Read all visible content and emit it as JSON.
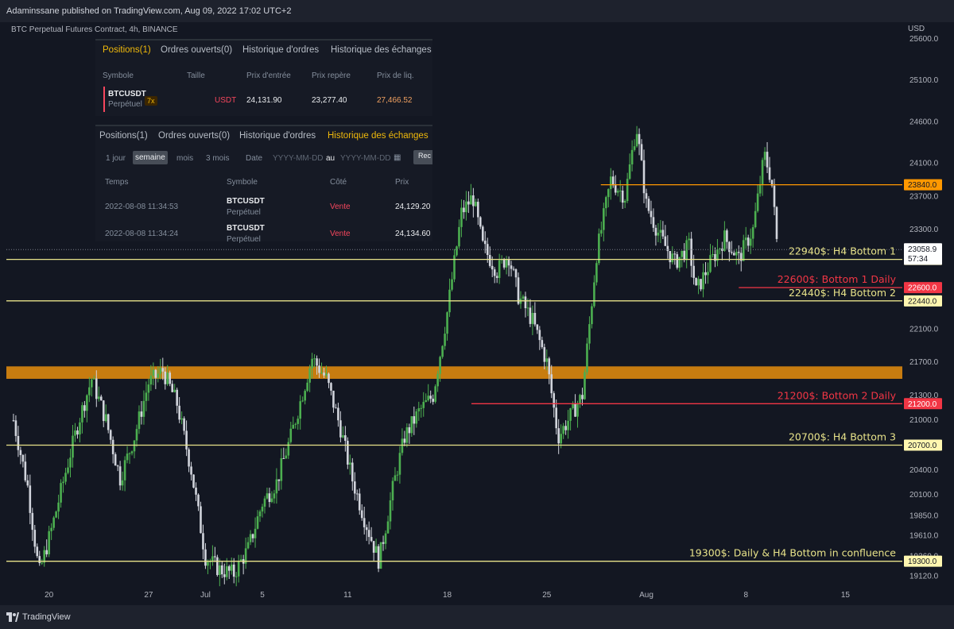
{
  "header": {
    "publish_text": "Adaminssane published on TradingView.com, Aug 09, 2022 17:02 UTC+2",
    "symbol_text": "BTC Perpetual Futures Contract, 4h, BINANCE",
    "currency": "USD"
  },
  "footer": {
    "brand": "TradingView"
  },
  "colors": {
    "background": "#131722",
    "up_candle": "#4caf50",
    "down_candle": "#d1d4dc",
    "support_line": "#e8e38a",
    "daily_line": "#f23645",
    "resistance": "#ff9800",
    "zone": "#c77c10"
  },
  "positions_panel": {
    "tabs": [
      "Positions(1)",
      "Ordres ouverts(0)",
      "Historique d'ordres",
      "Historique des échanges"
    ],
    "active_tab": 0,
    "headers": [
      "Symbole",
      "Taille",
      "Prix d'entrée",
      "Prix repère",
      "Prix de liq."
    ],
    "row": {
      "symbol": "BTCUSDT",
      "type": "Perpétuel",
      "leverage": "7x",
      "size_unit": "USDT",
      "entry": "24,131.90",
      "mark": "23,277.40",
      "liq": "27,466.52"
    }
  },
  "trades_panel": {
    "tabs": [
      "Positions(1)",
      "Ordres ouverts(0)",
      "Historique d'ordres",
      "Historique des échanges"
    ],
    "active_tab": 3,
    "filters": [
      "1 jour",
      "semaine",
      "mois",
      "3 mois"
    ],
    "active_filter": 1,
    "date_label": "Date",
    "date_from": "YYYY-MM-DD",
    "date_sep": "au",
    "date_to": "YYYY-MM-DD",
    "search_button": "Rec",
    "headers": [
      "Temps",
      "Symbole",
      "Côté",
      "Prix"
    ],
    "rows": [
      {
        "time": "2022-08-08 11:34:53",
        "symbol": "BTCUSDT",
        "type": "Perpétuel",
        "side": "Vente",
        "price": "24,129.20"
      },
      {
        "time": "2022-08-08 11:34:24",
        "symbol": "BTCUSDT",
        "type": "Perpétuel",
        "side": "Vente",
        "price": "24,134.60"
      }
    ]
  },
  "chart_data": {
    "type": "candlestick",
    "title": "BTC Perpetual Futures Contract, 4h, BINANCE",
    "ylabel": "USD",
    "ylim": [
      19000,
      25800
    ],
    "y_ticks": [
      "25600.0",
      "25100.0",
      "24600.0",
      "24100.0",
      "23700.0",
      "23300.0",
      "22100.0",
      "21700.0",
      "21300.0",
      "21000.0",
      "20400.0",
      "20100.0",
      "19850.0",
      "19610.0",
      "19360.0",
      "19120.0"
    ],
    "x_ticks": [
      "20",
      "27",
      "Jul",
      "5",
      "11",
      "18",
      "25",
      "Aug",
      "8",
      "15"
    ],
    "x_ticks_days": [
      20,
      27,
      31,
      35,
      41,
      48,
      55,
      62,
      69,
      76
    ],
    "x_range_days": [
      17,
      80
    ],
    "grid": false,
    "current_price": {
      "value": 23058.9,
      "label": "23058.9",
      "countdown": "57:34"
    },
    "levels": [
      {
        "price": 23840,
        "label_tag": "23840.0",
        "text": "",
        "color": "#ff9800",
        "start_day": 58.8
      },
      {
        "price": 22940,
        "label_tag": "22940.0",
        "text": "22940$: H4 Bottom 1",
        "color": "#e8e38a",
        "start_day": 17
      },
      {
        "price": 22600,
        "label_tag": "22600.0",
        "text": "22600$: Bottom 1 Daily",
        "color": "#f23645",
        "start_day": 68.5
      },
      {
        "price": 22440,
        "label_tag": "22440.0",
        "text": "22440$: H4 Bottom 2",
        "color": "#e8e38a",
        "start_day": 17
      },
      {
        "price": 21200,
        "label_tag": "21200.0",
        "text": "21200$: Bottom 2 Daily",
        "color": "#f23645",
        "start_day": 49.7
      },
      {
        "price": 20700,
        "label_tag": "20700.0",
        "text": "20700$: H4 Bottom 3",
        "color": "#e8e38a",
        "start_day": 17
      },
      {
        "price": 19300,
        "label_tag": "19300.0",
        "text": "19300$: Daily & H4 Bottom in confluence",
        "color": "#e8e38a",
        "start_day": 17
      }
    ],
    "zone": {
      "from": 21500,
      "to": 21650
    },
    "path": [
      [
        17.5,
        21000
      ],
      [
        18.5,
        20200
      ],
      [
        19.3,
        19150
      ],
      [
        20.2,
        19700
      ],
      [
        21.2,
        20400
      ],
      [
        22.1,
        21000
      ],
      [
        23,
        21500
      ],
      [
        24,
        21000
      ],
      [
        25,
        20300
      ],
      [
        26,
        20800
      ],
      [
        27,
        21450
      ],
      [
        28,
        21600
      ],
      [
        29,
        21200
      ],
      [
        30,
        20400
      ],
      [
        31,
        19350
      ],
      [
        32,
        19200
      ],
      [
        33,
        19150
      ],
      [
        34,
        19450
      ],
      [
        35,
        20000
      ],
      [
        36,
        20250
      ],
      [
        37,
        20800
      ],
      [
        38.5,
        21750
      ],
      [
        39.5,
        21500
      ],
      [
        40.5,
        20900
      ],
      [
        41.3,
        20300
      ],
      [
        42.2,
        19800
      ],
      [
        43.2,
        19300
      ],
      [
        44.2,
        20200
      ],
      [
        45,
        20800
      ],
      [
        46,
        21100
      ],
      [
        47,
        21300
      ],
      [
        48,
        22300
      ],
      [
        49,
        23500
      ],
      [
        49.8,
        23700
      ],
      [
        50.5,
        23100
      ],
      [
        51.5,
        22800
      ],
      [
        52.3,
        23000
      ],
      [
        53,
        22500
      ],
      [
        54,
        22200
      ],
      [
        55,
        21700
      ],
      [
        55.8,
        20800
      ],
      [
        56.5,
        21000
      ],
      [
        57.5,
        21300
      ],
      [
        58.5,
        23000
      ],
      [
        59.5,
        23900
      ],
      [
        60.5,
        23700
      ],
      [
        61.3,
        24550
      ],
      [
        62,
        23600
      ],
      [
        63,
        23200
      ],
      [
        64,
        22900
      ],
      [
        65,
        23100
      ],
      [
        65.5,
        22550
      ],
      [
        66.5,
        22900
      ],
      [
        67.5,
        23200
      ],
      [
        68.5,
        22950
      ],
      [
        69.5,
        23300
      ],
      [
        70.3,
        24200
      ],
      [
        70.8,
        23900
      ],
      [
        71.2,
        23100
      ]
    ]
  }
}
